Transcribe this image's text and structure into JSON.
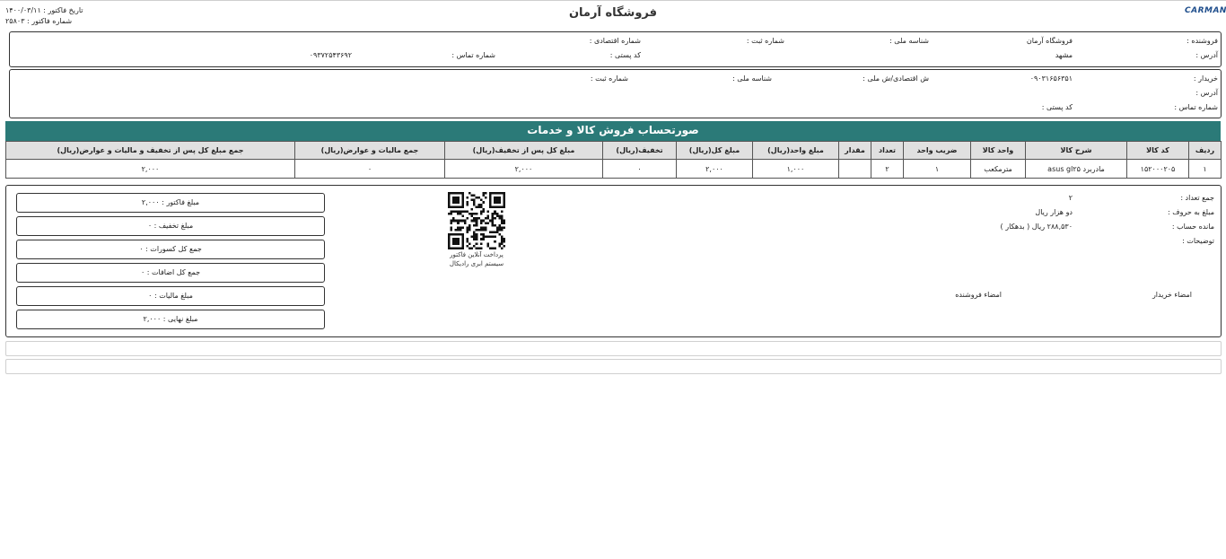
{
  "header": {
    "store_title": "فروشگاه آرمان",
    "logo_text": "CARMAN",
    "invoice_date": "تاریخ فاکتور : ۱۴۰۰/۰۳/۱۱",
    "invoice_number": "شماره فاکتور : ۲۵۸۰۳"
  },
  "seller": {
    "seller_label": "فروشنده :",
    "seller_value": "فروشگاه آرمان",
    "national_id_label": "شناسه ملی :",
    "reg_number_label": "شماره ثبت :",
    "economic_code_label": "شماره اقتصادی :",
    "address_label": "آدرس :",
    "address_value": "مشهد",
    "postal_code_label": "کد پستی :",
    "phone_label": "شماره تماس :",
    "phone_value": "۰۹۳۷۲۵۴۳۶۹۲"
  },
  "buyer": {
    "buyer_label": "خریدار :",
    "buyer_value": "۰۹۰۳۱۶۵۶۳۵۱",
    "economic_id_label": "ش اقتصادی/ش ملی :",
    "national_id_label": "شناسه ملی :",
    "reg_number_label": "شماره ثبت :",
    "address_label": "آدرس :",
    "phone_label": "شماره تماس :",
    "postal_code_label": "کد پستی :"
  },
  "banner": {
    "title": "صورتحساب فروش کالا و خدمات"
  },
  "table": {
    "headers": [
      "جمع مبلغ کل پس از تخفیف و مالیات و عوارض(ریال)",
      "جمع مالیات و عوارض(ریال)",
      "مبلغ کل پس از تخفیف(ریال)",
      "تخفیف(ریال)",
      "مبلغ کل(ریال)",
      "مبلغ واحد(ریال)",
      "مقدار",
      "تعداد",
      "ضریب واحد",
      "واحد کالا",
      "شرح کالا",
      "کد کالا",
      "ردیف"
    ],
    "rows": [
      [
        "۲,۰۰۰",
        "۰",
        "۲,۰۰۰",
        "۰",
        "۲,۰۰۰",
        "۱,۰۰۰",
        "",
        "۲",
        "۱",
        "مترمکعب",
        "مادربرد asus gl۲۵",
        "۱۵۲۰۰۰۲۰۵",
        "۱"
      ]
    ]
  },
  "summary": {
    "total_count_label": "جمع تعداد :",
    "total_count_value": "۲",
    "amount_words_label": "مبلغ به حروف :",
    "amount_words_value": "دو هزار ریال",
    "balance_label": "مانده حساب :",
    "balance_value": "۲۸۸,۵۳۰ ریال ( بدهکار )",
    "notes_label": "توضیحات :",
    "buyer_signature": "امضاء خریدار",
    "seller_signature": "امضاء فروشنده",
    "qr_caption_1": "پرداخت آنلاین فاکتور",
    "qr_caption_2": "سیستم ابری رادیکال",
    "totals": [
      "مبلغ فاکتور : ۲,۰۰۰",
      "مبلغ تخفیف : ۰",
      "جمع کل کسورات : ۰",
      "جمع کل اضافات : ۰",
      "مبلغ مالیات : ۰",
      "مبلغ نهایی : ۲,۰۰۰"
    ]
  }
}
